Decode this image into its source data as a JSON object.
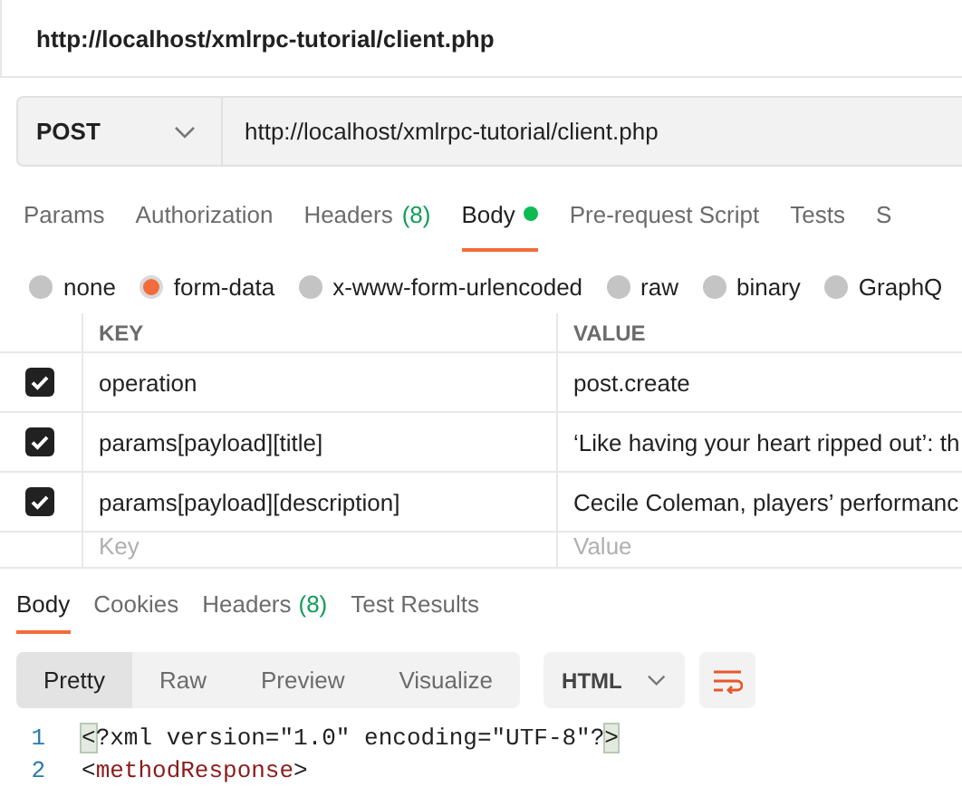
{
  "window": {
    "title": "http://localhost/xmlrpc-tutorial/client.php"
  },
  "request": {
    "method": "POST",
    "url": "http://localhost/xmlrpc-tutorial/client.php"
  },
  "request_tabs": [
    {
      "label": "Params",
      "selected": false
    },
    {
      "label": "Authorization",
      "selected": false
    },
    {
      "label": "Headers",
      "count": "(8)",
      "selected": false
    },
    {
      "label": "Body",
      "selected": true,
      "dot": true
    },
    {
      "label": "Pre-request Script",
      "selected": false
    },
    {
      "label": "Tests",
      "selected": false
    },
    {
      "label": "S",
      "selected": false
    }
  ],
  "body_types": [
    {
      "label": "none",
      "selected": false
    },
    {
      "label": "form-data",
      "selected": true
    },
    {
      "label": "x-www-form-urlencoded",
      "selected": false
    },
    {
      "label": "raw",
      "selected": false
    },
    {
      "label": "binary",
      "selected": false
    },
    {
      "label": "GraphQ",
      "selected": false
    }
  ],
  "form_table": {
    "columns": [
      "KEY",
      "VALUE"
    ],
    "rows": [
      {
        "checked": true,
        "key": "operation",
        "value": "post.create"
      },
      {
        "checked": true,
        "key": "params[payload][title]",
        "value": "‘Like having your heart ripped out’: th"
      },
      {
        "checked": true,
        "key": "params[payload][description]",
        "value": "Cecile Coleman, players’ performanc"
      }
    ],
    "new_row": {
      "key_placeholder": "Key",
      "value_placeholder": "Value"
    }
  },
  "response_tabs": [
    {
      "label": "Body",
      "selected": true
    },
    {
      "label": "Cookies",
      "selected": false
    },
    {
      "label": "Headers",
      "count": "(8)",
      "selected": false
    },
    {
      "label": "Test Results",
      "selected": false
    }
  ],
  "view_modes": [
    {
      "label": "Pretty",
      "selected": true
    },
    {
      "label": "Raw",
      "selected": false
    },
    {
      "label": "Preview",
      "selected": false
    },
    {
      "label": "Visualize",
      "selected": false
    }
  ],
  "format": "HTML",
  "code_lines": [
    {
      "number": "1",
      "parts": [
        {
          "kind": "bracket",
          "text": "<"
        },
        {
          "kind": "plain",
          "text": "?xml version=\"1.0\" encoding=\"UTF-8\"?"
        },
        {
          "kind": "bracket",
          "text": ">"
        }
      ]
    },
    {
      "number": "2",
      "parts": [
        {
          "kind": "plain",
          "text": "<"
        },
        {
          "kind": "tag",
          "text": "methodResponse"
        },
        {
          "kind": "plain",
          "text": ">"
        }
      ]
    }
  ]
}
